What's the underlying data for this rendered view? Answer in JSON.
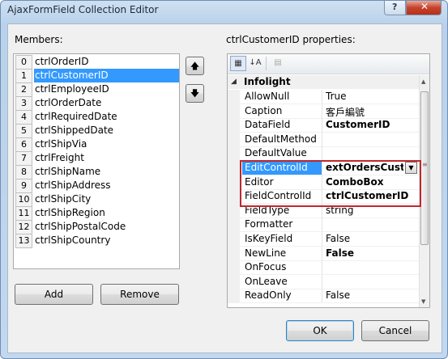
{
  "window": {
    "title": "AjaxFormField Collection Editor",
    "help_glyph": "?",
    "close_glyph": "✕"
  },
  "members": {
    "label": "Members:",
    "items": [
      {
        "index": "0",
        "name": "ctrlOrderID"
      },
      {
        "index": "1",
        "name": "ctrlCustomerID"
      },
      {
        "index": "2",
        "name": "ctrlEmployeeID"
      },
      {
        "index": "3",
        "name": "ctrlOrderDate"
      },
      {
        "index": "4",
        "name": "ctrlRequiredDate"
      },
      {
        "index": "5",
        "name": "ctrlShippedDate"
      },
      {
        "index": "6",
        "name": "ctrlShipVia"
      },
      {
        "index": "7",
        "name": "ctrlFreight"
      },
      {
        "index": "8",
        "name": "ctrlShipName"
      },
      {
        "index": "9",
        "name": "ctrlShipAddress"
      },
      {
        "index": "10",
        "name": "ctrlShipCity"
      },
      {
        "index": "11",
        "name": "ctrlShipRegion"
      },
      {
        "index": "12",
        "name": "ctrlShipPostalCode"
      },
      {
        "index": "13",
        "name": "ctrlShipCountry"
      }
    ],
    "selected_index": 1,
    "move_up_glyph": "🡅",
    "move_down_glyph": "🡇"
  },
  "buttons": {
    "add": "Add",
    "remove": "Remove",
    "ok": "OK",
    "cancel": "Cancel"
  },
  "properties": {
    "label": "ctrlCustomerID properties:",
    "toolbar": {
      "categorized_glyph": "▦",
      "alphabetical_glyph": "↓A",
      "pages_glyph": "▤"
    },
    "category": {
      "toggle": "◢",
      "name": "Infolight"
    },
    "rows": [
      {
        "name": "AllowNull",
        "value": "True",
        "bold": false
      },
      {
        "name": "Caption",
        "value": "客戶編號",
        "bold": false
      },
      {
        "name": "DataField",
        "value": "CustomerID",
        "bold": true
      },
      {
        "name": "DefaultMethod",
        "value": "",
        "bold": false
      },
      {
        "name": "DefaultValue",
        "value": "",
        "bold": false
      },
      {
        "name": "EditControlId",
        "value": "extOrdersCustomer",
        "bold": true
      },
      {
        "name": "Editor",
        "value": "ComboBox",
        "bold": true
      },
      {
        "name": "FieldControlId",
        "value": "ctrlCustomerID",
        "bold": true
      },
      {
        "name": "FieldType",
        "value": "string",
        "bold": false
      },
      {
        "name": "Formatter",
        "value": "",
        "bold": false
      },
      {
        "name": "IsKeyField",
        "value": "False",
        "bold": false
      },
      {
        "name": "NewLine",
        "value": "False",
        "bold": true
      },
      {
        "name": "OnFocus",
        "value": "",
        "bold": false
      },
      {
        "name": "OnLeave",
        "value": "",
        "bold": false
      },
      {
        "name": "ReadOnly",
        "value": "False",
        "bold": false
      }
    ],
    "selected_row": 5,
    "dropdown_glyph": "▼",
    "scroll_up_glyph": "▲",
    "scroll_down_glyph": "▼",
    "thumb_grip": "≡"
  },
  "colors": {
    "selection": "#3399ff",
    "highlight_box": "#c0272d"
  }
}
